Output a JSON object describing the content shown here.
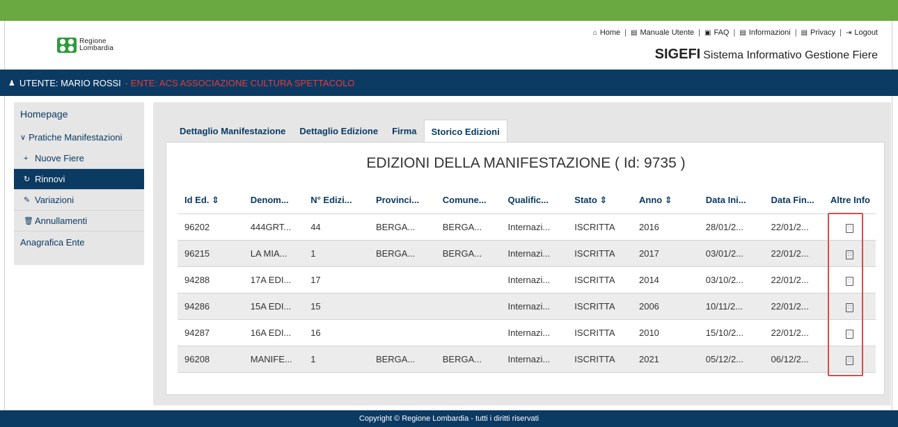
{
  "header": {
    "logo_line1": "Regione",
    "logo_line2": "Lombardia",
    "nav": [
      {
        "icon": "home-icon",
        "glyph": "⌂",
        "label": "Home"
      },
      {
        "icon": "document-icon",
        "glyph": "▤",
        "label": "Manuale Utente"
      },
      {
        "icon": "book-icon",
        "glyph": "▣",
        "label": "FAQ"
      },
      {
        "icon": "document-icon",
        "glyph": "▤",
        "label": "Informazioni"
      },
      {
        "icon": "document-icon",
        "glyph": "▤",
        "label": "Privacy"
      },
      {
        "icon": "logout-icon",
        "glyph": "⇥",
        "label": "Logout"
      }
    ],
    "app_acronym": "SIGEFI",
    "app_name": "Sistema Informativo Gestione Fiere"
  },
  "userbar": {
    "user": "UTENTE: MARIO ROSSI",
    "ente": "- ENTE: ACS ASSOCIAZIONE CULTURA SPETTACOLO"
  },
  "sidebar": {
    "homepage": "Homepage",
    "group": "Pratiche Manifestazioni",
    "items": [
      {
        "icon": "plus-icon",
        "glyph": "+",
        "label": "Nuove Fiere"
      },
      {
        "icon": "refresh-icon",
        "glyph": "↻",
        "label": "Rinnovi"
      },
      {
        "icon": "pencil-icon",
        "glyph": "✎",
        "label": "Variazioni"
      },
      {
        "icon": "trash-icon",
        "glyph": "🗑",
        "label": "Annullamenti"
      }
    ],
    "anagrafica": "Anagrafica Ente"
  },
  "tabs": [
    "Dettaglio Manifestazione",
    "Dettaglio Edizione",
    "Firma",
    "Storico Edizioni"
  ],
  "title": "EDIZIONI DELLA MANIFESTAZIONE ( Id: 9735 )",
  "table": {
    "columns": [
      "Id Ed. ⇕",
      "Denom...",
      "N° Edizi...",
      "Provinci...",
      "Comune...",
      "Qualific...",
      "Stato ⇕",
      "Anno ⇕",
      "Data Ini...",
      "Data Fin...",
      "Altre Info"
    ],
    "rows": [
      [
        "96202",
        "444GRT...",
        "44",
        "BERGA...",
        "BERGA...",
        "Internazi...",
        "ISCRITTA",
        "2016",
        "28/01/2...",
        "22/01/2..."
      ],
      [
        "96215",
        "LA MIA...",
        "1",
        "BERGA...",
        "BERGA...",
        "Internazi...",
        "ISCRITTA",
        "2017",
        "03/01/2...",
        "22/01/2..."
      ],
      [
        "94288",
        "17A EDI...",
        "17",
        "",
        "",
        "Internazi...",
        "ISCRITTA",
        "2014",
        "03/10/2...",
        "22/01/2..."
      ],
      [
        "94286",
        "15A EDI...",
        "15",
        "",
        "",
        "Internazi...",
        "ISCRITTA",
        "2006",
        "10/11/2...",
        "22/01/2..."
      ],
      [
        "94287",
        "16A EDI...",
        "16",
        "",
        "",
        "Internazi...",
        "ISCRITTA",
        "2010",
        "15/10/2...",
        "22/01/2..."
      ],
      [
        "96208",
        "MANIFE...",
        "1",
        "BERGA...",
        "BERGA...",
        "Internazi...",
        "ISCRITTA",
        "2021",
        "05/12/2...",
        "06/12/2..."
      ]
    ]
  },
  "footer": "Copyright © Regione Lombardia - tutti i diritti riservati",
  "colors": {
    "navy": "#0b3a63",
    "green": "#6aa842",
    "ente_red": "#e43a3a",
    "highlight": "#d94b4b"
  }
}
